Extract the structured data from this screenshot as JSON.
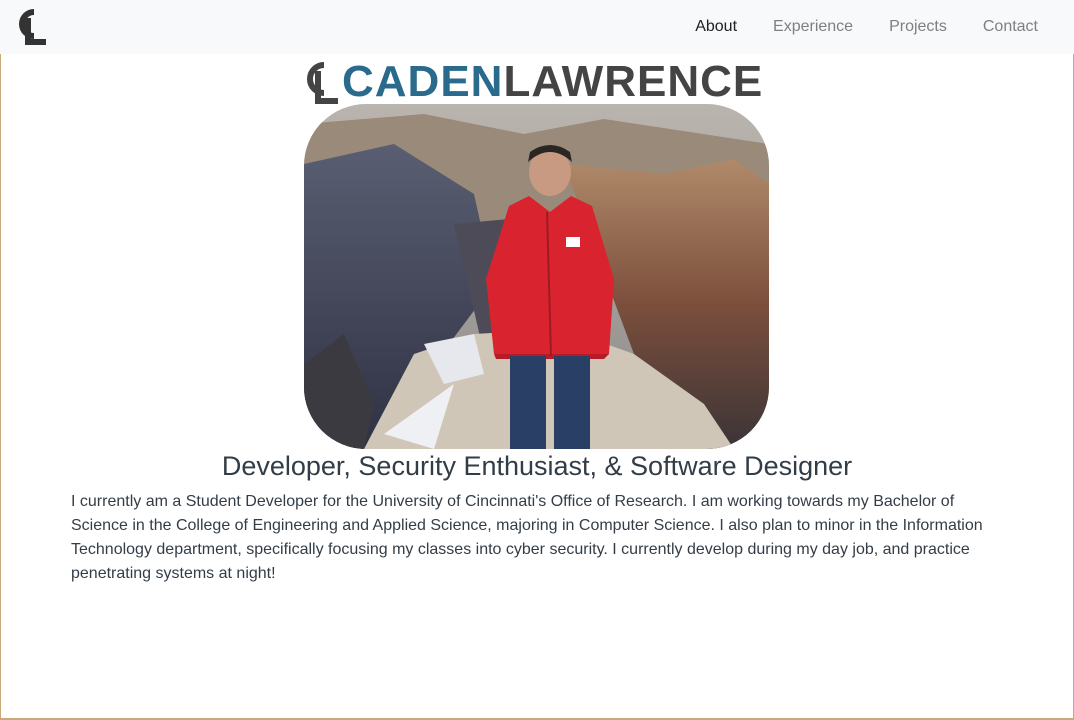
{
  "brand": {
    "monogram": "CL"
  },
  "nav": {
    "items": [
      {
        "label": "About",
        "active": true
      },
      {
        "label": "Experience",
        "active": false
      },
      {
        "label": "Projects",
        "active": false
      },
      {
        "label": "Contact",
        "active": false
      }
    ]
  },
  "logo": {
    "first": "CADEN",
    "last": "LAWRENCE"
  },
  "colors": {
    "logo_first": "#2a6a8c",
    "logo_last": "#444444",
    "border": "#c9a97a",
    "navbar_bg": "#f8f9fa"
  },
  "headline": "Developer, Security Enthusiast, & Software Designer",
  "bio": "I currently am a Student Developer for the University of Cincinnati's Office of Research. I am working towards my Bachelor of Science in the College of Engineering and Applied Science, majoring in Computer Science. I also plan to minor in the Information Technology department, specifically focusing my classes into cyber security. I currently develop during my day job, and practice penetrating systems at night!"
}
